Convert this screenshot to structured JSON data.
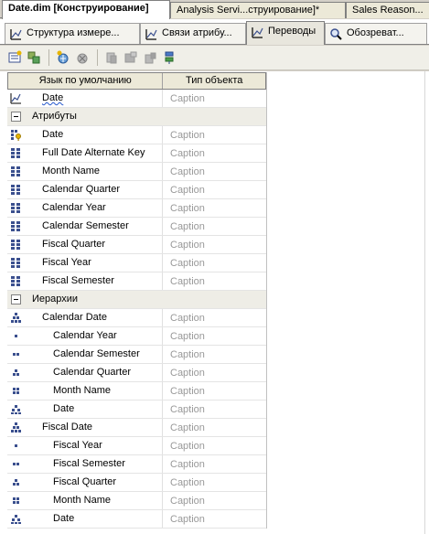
{
  "document_tabs": [
    {
      "label": "Date.dim [Конструирование]",
      "active": true
    },
    {
      "label": "Analysis Servi...струирование]*",
      "active": false
    },
    {
      "label": "Sales Reason...",
      "active": false
    }
  ],
  "designer_tabs": [
    {
      "label": "Структура измере...",
      "icon": "dimension-structure-icon",
      "active": false
    },
    {
      "label": "Связи атрибу...",
      "icon": "attribute-relationships-icon",
      "active": false
    },
    {
      "label": "Переводы",
      "icon": "translations-icon",
      "active": true
    },
    {
      "label": "Обозреват...",
      "icon": "browser-icon",
      "active": false
    }
  ],
  "toolbar": {
    "buttons": [
      {
        "name": "new-caption-icon",
        "enabled": true
      },
      {
        "name": "show-all-icon",
        "enabled": true
      },
      {
        "name": "new-translation-icon",
        "enabled": true
      },
      {
        "name": "delete-translation-icon",
        "enabled": false
      },
      {
        "name": "cut-icon",
        "enabled": false
      },
      {
        "name": "copy-icon",
        "enabled": false
      },
      {
        "name": "paste-icon",
        "enabled": false
      },
      {
        "name": "sort-icon",
        "enabled": true
      }
    ]
  },
  "grid": {
    "columns": [
      "Язык по умолчанию",
      "Тип объекта"
    ],
    "rows": [
      {
        "type": "item",
        "label": "Date",
        "value": "Caption",
        "icon": "dimension-icon",
        "indent": 0,
        "squiggle": true
      },
      {
        "type": "group",
        "label": "Атрибуты",
        "value": ""
      },
      {
        "type": "item",
        "label": "Date",
        "value": "Caption",
        "icon": "key-attribute-icon",
        "indent": 0
      },
      {
        "type": "item",
        "label": "Full Date Alternate Key",
        "value": "Caption",
        "icon": "attribute-icon",
        "indent": 0
      },
      {
        "type": "item",
        "label": "Month Name",
        "value": "Caption",
        "icon": "attribute-icon",
        "indent": 0
      },
      {
        "type": "item",
        "label": "Calendar Quarter",
        "value": "Caption",
        "icon": "attribute-icon",
        "indent": 0
      },
      {
        "type": "item",
        "label": "Calendar Year",
        "value": "Caption",
        "icon": "attribute-icon",
        "indent": 0
      },
      {
        "type": "item",
        "label": "Calendar Semester",
        "value": "Caption",
        "icon": "attribute-icon",
        "indent": 0
      },
      {
        "type": "item",
        "label": "Fiscal Quarter",
        "value": "Caption",
        "icon": "attribute-icon",
        "indent": 0
      },
      {
        "type": "item",
        "label": "Fiscal Year",
        "value": "Caption",
        "icon": "attribute-icon",
        "indent": 0
      },
      {
        "type": "item",
        "label": "Fiscal Semester",
        "value": "Caption",
        "icon": "attribute-icon",
        "indent": 0
      },
      {
        "type": "group",
        "label": "Иерархии",
        "value": ""
      },
      {
        "type": "item",
        "label": "Calendar Date",
        "value": "Caption",
        "icon": "hierarchy-icon",
        "indent": 0
      },
      {
        "type": "item",
        "label": "Calendar Year",
        "value": "Caption",
        "icon": "level1-icon",
        "indent": 1
      },
      {
        "type": "item",
        "label": "Calendar Semester",
        "value": "Caption",
        "icon": "level2-icon",
        "indent": 1
      },
      {
        "type": "item",
        "label": "Calendar Quarter",
        "value": "Caption",
        "icon": "level3-icon",
        "indent": 1
      },
      {
        "type": "item",
        "label": "Month Name",
        "value": "Caption",
        "icon": "level4-icon",
        "indent": 1
      },
      {
        "type": "item",
        "label": "Date",
        "value": "Caption",
        "icon": "level5-icon",
        "indent": 1
      },
      {
        "type": "item",
        "label": "Fiscal Date",
        "value": "Caption",
        "icon": "hierarchy-icon",
        "indent": 0
      },
      {
        "type": "item",
        "label": "Fiscal Year",
        "value": "Caption",
        "icon": "level1-icon",
        "indent": 1
      },
      {
        "type": "item",
        "label": "Fiscal Semester",
        "value": "Caption",
        "icon": "level2-icon",
        "indent": 1
      },
      {
        "type": "item",
        "label": "Fiscal Quarter",
        "value": "Caption",
        "icon": "level3-icon",
        "indent": 1
      },
      {
        "type": "item",
        "label": "Month Name",
        "value": "Caption",
        "icon": "level4-icon",
        "indent": 1
      },
      {
        "type": "item",
        "label": "Date",
        "value": "Caption",
        "icon": "level5-icon",
        "indent": 1
      }
    ]
  },
  "colors": {
    "icon_blue": "#3a4f8e",
    "icon_yellow": "#e6b400",
    "caption_gray": "#999999",
    "group_bg": "#eeede6"
  }
}
